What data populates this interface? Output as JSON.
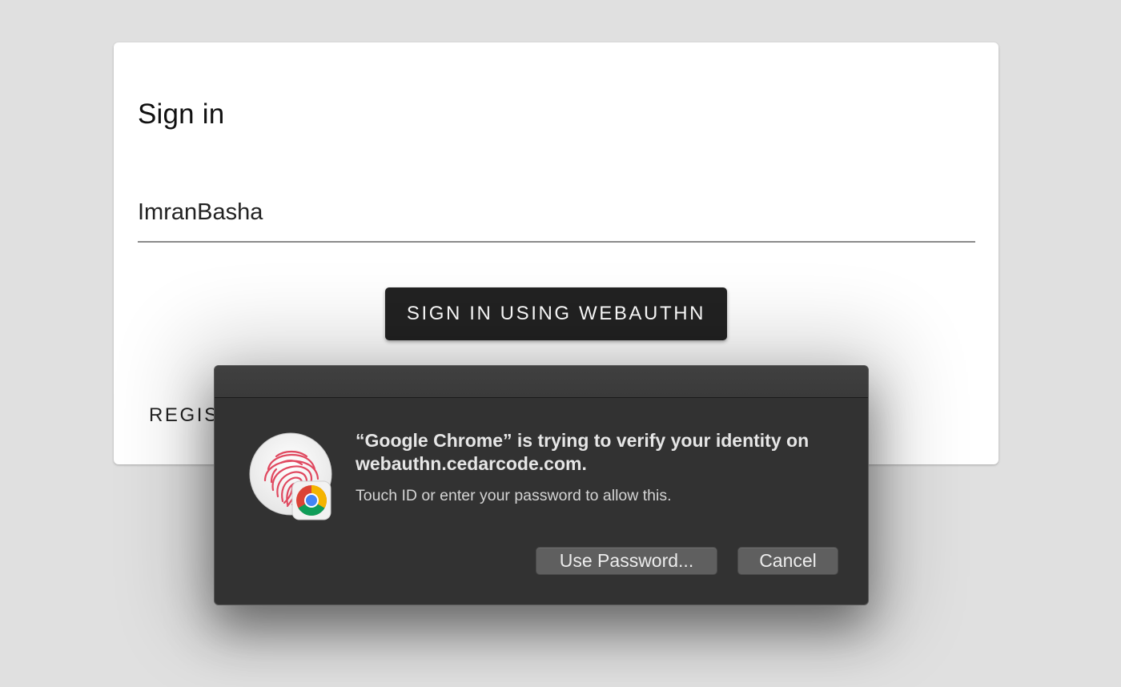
{
  "signin_card": {
    "title": "Sign in",
    "username_value": "ImranBasha",
    "webauthn_button_label": "SIGN IN USING WEBAUTHN",
    "register_button_label": "REGISTER"
  },
  "touchid_dialog": {
    "heading": "“Google Chrome” is trying to verify your identity on webauthn.cedarcode.com.",
    "subtext": "Touch ID or enter your password to allow this.",
    "use_password_label": "Use Password...",
    "cancel_label": "Cancel",
    "icons": [
      "fingerprint-icon",
      "chrome-logo-icon"
    ]
  },
  "colors": {
    "page_background": "#e0e0e0",
    "card_background": "#ffffff",
    "primary_button": "#222222",
    "dialog_background": "#323232",
    "dialog_button": "#5f5f5f",
    "fingerprint": "#e0485f"
  }
}
